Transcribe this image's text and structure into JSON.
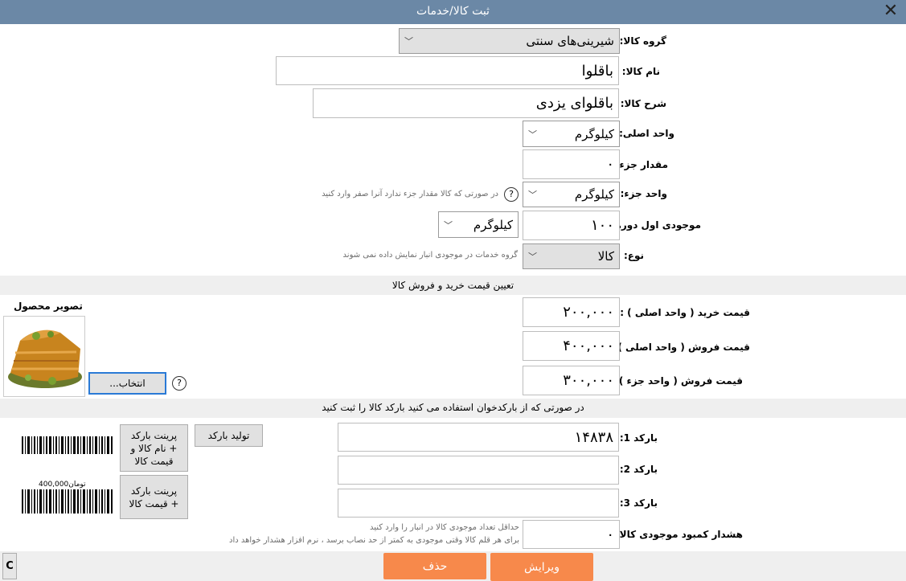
{
  "window": {
    "title": "ثبت کالا/خدمات"
  },
  "form": {
    "group_label": "گروه کالا:",
    "group_value": "شیرینی‌های سنتی",
    "name_label": "نام کالا:",
    "name_value": "باقلوا",
    "desc_label": "شرح کالا:",
    "desc_value": "باقلوای یزدی",
    "main_unit_label": "واحد اصلی:",
    "main_unit_value": "کیلوگرم",
    "part_amount_label": "مقدار جزء:",
    "part_amount_value": "۰",
    "part_unit_label": "واحد جزء:",
    "part_unit_value": "کیلوگرم",
    "part_unit_hint": "در صورتی که کالا مقدار جزء ندارد آنرا صفر وارد کنید",
    "opening_stock_label": "موجودی اول دوره:",
    "opening_stock_value": "۱۰۰",
    "opening_stock_unit": "کیلوگرم",
    "type_label": "نوع:",
    "type_value": "کالا",
    "type_hint": "گروه خدمات در موجودی انبار نمایش داده نمی شوند"
  },
  "pricing": {
    "section_title": "تعیین قیمت خرید و فروش کالا",
    "buy_label": "قیمت خرید ( واحد اصلی ) :",
    "buy_value": "۲۰۰,۰۰۰",
    "sell_main_label": "قیمت فروش ( واحد اصلی ) :",
    "sell_main_value": "۴۰۰,۰۰۰",
    "sell_part_label": "قیمت فروش ( واحد جزء ) :",
    "sell_part_value": "۳۰۰,۰۰۰"
  },
  "image": {
    "label": "تصویر محصول",
    "choose_button": "انتخاب..."
  },
  "barcode": {
    "section_title": "در صورتی که از بارکدخوان استفاده می کنید بارکد کالا را ثبت کنید",
    "b1_label": "بارکد 1:",
    "b1_value": "۱۴۸۳۸",
    "b2_label": "بارکد 2:",
    "b2_value": "",
    "b3_label": "بارکد 3:",
    "b3_value": "",
    "generate_button": "تولید بارکد",
    "print_full_button": "پرینت بارکد + نام کالا و قیمت کالا",
    "print_price_button": "پرینت بارکد + قیمت کالا",
    "preview_price": "تومان400,000"
  },
  "stock_alert": {
    "label": "هشدار کمبود موجودی کالا:",
    "value": "۰",
    "hint_line1": "حداقل تعداد موجودی کالا در انبار را وارد کنید",
    "hint_line2": "برای هر قلم کالا وقتی موجودی به کمتر از حد نصاب برسد ، نرم افزار هشدار خواهد داد"
  },
  "actions": {
    "edit": "ویرایش",
    "delete": "حذف",
    "c_button": "C"
  }
}
